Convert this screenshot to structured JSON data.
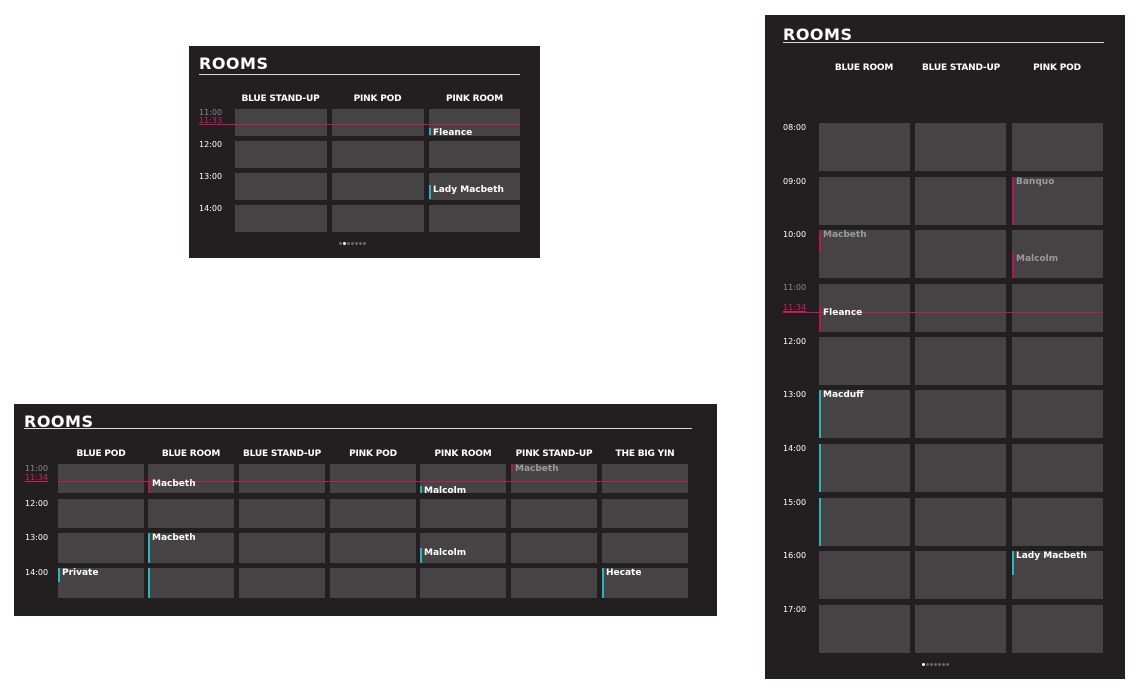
{
  "brand": {
    "teal": "#2bb3c0",
    "pink": "#b0185a",
    "panel_bg": "#231f20",
    "cell_bg": "#454344"
  },
  "panel_small": {
    "title": "ROOMS",
    "columns": [
      "BLUE STAND-UP",
      "PINK POD",
      "PINK ROOM"
    ],
    "times": [
      "11:00",
      "12:00",
      "13:00",
      "14:00"
    ],
    "now": "11:33",
    "events": [
      {
        "label": "Fleance",
        "status": "active"
      },
      {
        "label": "Lady Macbeth",
        "status": "upcoming"
      }
    ],
    "pager": {
      "count": 7,
      "active": 1
    }
  },
  "panel_wide": {
    "title": "ROOMS",
    "columns": [
      "BLUE POD",
      "BLUE ROOM",
      "BLUE STAND-UP",
      "PINK POD",
      "PINK ROOM",
      "PINK STAND-UP",
      "THE BIG YIN"
    ],
    "times": [
      "11:00",
      "12:00",
      "13:00",
      "14:00"
    ],
    "now": "11:34",
    "events": [
      {
        "label": "Macbeth",
        "status": "active"
      },
      {
        "label": "Malcolm",
        "status": "active"
      },
      {
        "label": "Macbeth",
        "status": "past"
      },
      {
        "label": "Macbeth",
        "status": "upcoming"
      },
      {
        "label": "Malcolm",
        "status": "upcoming"
      },
      {
        "label": "Private",
        "status": "upcoming"
      },
      {
        "label": "Hecate",
        "status": "upcoming"
      }
    ]
  },
  "panel_tall": {
    "title": "ROOMS",
    "columns": [
      "BLUE ROOM",
      "BLUE STAND-UP",
      "PINK POD"
    ],
    "times": [
      "08:00",
      "09:00",
      "10:00",
      "11:00",
      "12:00",
      "13:00",
      "14:00",
      "15:00",
      "16:00",
      "17:00"
    ],
    "now": "11:34",
    "events": [
      {
        "label": "Banquo",
        "status": "past"
      },
      {
        "label": "Macbeth",
        "status": "past"
      },
      {
        "label": "Malcolm",
        "status": "past"
      },
      {
        "label": "Fleance",
        "status": "active"
      },
      {
        "label": "Macduff",
        "status": "upcoming"
      },
      {
        "label": "Lady Macbeth",
        "status": "upcoming"
      }
    ],
    "pager": {
      "count": 7,
      "active": 0
    }
  }
}
